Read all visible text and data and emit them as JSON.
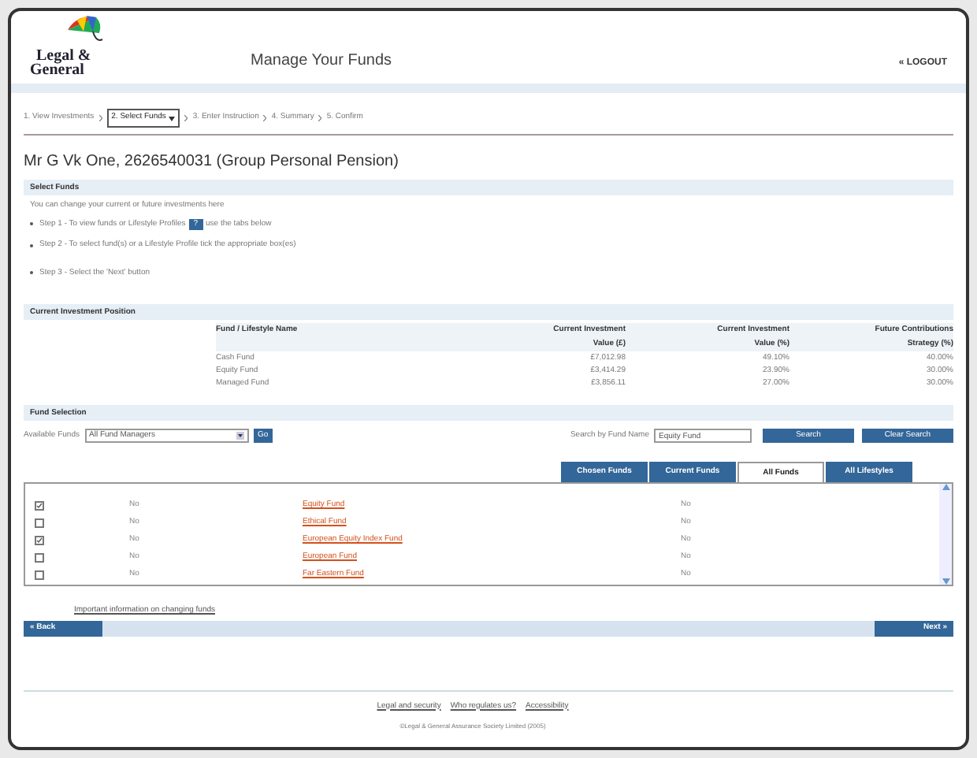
{
  "header": {
    "logo_text": [
      "Legal &",
      "General"
    ],
    "title": "Manage Your Funds",
    "logout": "« LOGOUT"
  },
  "breadcrumb": [
    {
      "label": "1. View Investments",
      "selected": false
    },
    {
      "label": "2. Select Funds",
      "selected": true
    },
    {
      "label": "3. Enter Instruction",
      "selected": false
    },
    {
      "label": "4. Summary",
      "selected": false
    },
    {
      "label": "5. Confirm",
      "selected": false
    }
  ],
  "heading": "Mr G Vk One, 2626540031 (Group Personal Pension)",
  "select_funds": {
    "title": "Select Funds",
    "intro": "You can change your current or future investments here",
    "steps": [
      {
        "text": "Step 1 - To view funds or Lifestyle Profiles",
        "help": "?",
        "after": "use the tabs below"
      },
      {
        "text": "Step 2 - To select fund(s) or a Lifestyle Profile tick the appropriate box(es)"
      },
      {
        "text": "Step 3 - Select the 'Next' button"
      }
    ]
  },
  "position": {
    "title": "Current Investment Position",
    "columns": [
      "Fund / Lifestyle Name",
      "Current Investment Value (£)",
      "Current Investment Value (%)",
      "Future Contributions Strategy (%)"
    ],
    "rows": [
      [
        "Cash Fund",
        "£7,012.98",
        "49.10%",
        "40.00%"
      ],
      [
        "Equity Fund",
        "£3,414.29",
        "23.90%",
        "30.00%"
      ],
      [
        "Managed Fund",
        "£3,856.11",
        "27.00%",
        "30.00%"
      ]
    ]
  },
  "fund_selection": {
    "title": "Fund Selection",
    "available_label": "Available Funds",
    "available_value": "All Fund Managers",
    "go": "Go",
    "search_label": "Search by Fund Name",
    "search_value": "Equity Fund",
    "search_button": "Search",
    "clear_button": "Clear Search",
    "tabs": [
      {
        "label": "Chosen Funds",
        "selected": false
      },
      {
        "label": "Current Funds",
        "selected": false
      },
      {
        "label": "All Funds",
        "selected": true
      },
      {
        "label": "All Lifestyles",
        "selected": false
      }
    ],
    "rows": [
      {
        "checked": true,
        "column_2": "No",
        "name": "Equity Fund",
        "column_4": "No"
      },
      {
        "checked": false,
        "column_2": "No",
        "name": "Ethical Fund",
        "column_4": "No"
      },
      {
        "checked": true,
        "column_2": "No",
        "name": "European Equity Index Fund",
        "column_4": "No"
      },
      {
        "checked": false,
        "column_2": "No",
        "name": "European Fund",
        "column_4": "No"
      },
      {
        "checked": false,
        "column_2": "No",
        "name": "Far Eastern Fund",
        "column_4": "No"
      }
    ]
  },
  "info_link": "Important information on changing funds",
  "back": "« Back",
  "next": "Next »",
  "footer": {
    "links": [
      "Legal and security",
      "Who regulates us?",
      "Accessibility"
    ],
    "copyright": "©Legal & General Assurance Society Limited (2005)"
  }
}
